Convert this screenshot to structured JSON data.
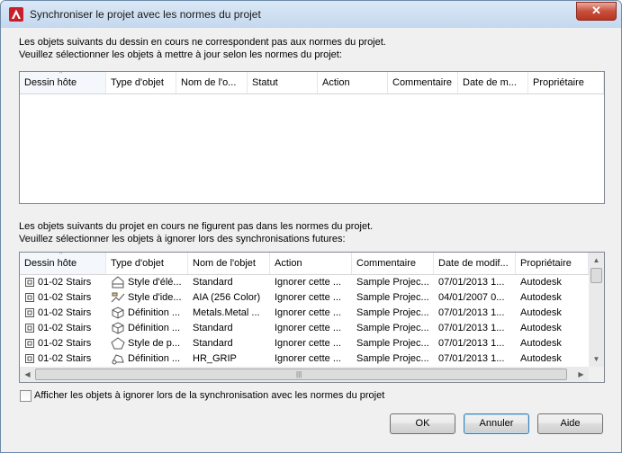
{
  "window": {
    "title": "Synchroniser le projet avec les normes du projet",
    "close_symbol": "✕"
  },
  "upper": {
    "intro_line1": "Les objets suivants du dessin en cours ne correspondent pas aux normes du projet.",
    "intro_line2": "Veuillez sélectionner les objets à mettre à jour selon les normes du projet:",
    "columns": [
      "Dessin hôte",
      "Type d'objet",
      "Nom de l'o...",
      "Statut",
      "Action",
      "Commentaire",
      "Date de m...",
      "Propriétaire"
    ]
  },
  "lower": {
    "intro_line1": "Les objets suivants du projet en cours ne figurent pas dans les normes du projet.",
    "intro_line2": "Veuillez sélectionner les objets à ignorer lors des synchronisations futures:",
    "columns": [
      "Dessin hôte",
      "Type d'objet",
      "Nom de l'objet",
      "Action",
      "Commentaire",
      "Date de modif...",
      "Propriétaire"
    ],
    "rows": [
      {
        "icon": "wall-style-icon",
        "host": "01-02 Stairs",
        "type": "Style d'élé...",
        "name": "Standard",
        "action": "Ignorer cette ...",
        "comment": "Sample Projec...",
        "date": "07/01/2013 1...",
        "owner": "Autodesk"
      },
      {
        "icon": "display-style-icon",
        "host": "01-02 Stairs",
        "type": "Style d'ide...",
        "name": "AIA (256 Color)",
        "action": "Ignorer cette ...",
        "comment": "Sample Projec...",
        "date": "04/01/2007 0...",
        "owner": "Autodesk"
      },
      {
        "icon": "material-definition-icon",
        "host": "01-02 Stairs",
        "type": "Définition ...",
        "name": "Metals.Metal ...",
        "action": "Ignorer cette ...",
        "comment": "Sample Projec...",
        "date": "07/01/2013 1...",
        "owner": "Autodesk"
      },
      {
        "icon": "material-definition-icon",
        "host": "01-02 Stairs",
        "type": "Définition ...",
        "name": "Standard",
        "action": "Ignorer cette ...",
        "comment": "Sample Projec...",
        "date": "07/01/2013 1...",
        "owner": "Autodesk"
      },
      {
        "icon": "pentagon-style-icon",
        "host": "01-02 Stairs",
        "type": "Style de p...",
        "name": "Standard",
        "action": "Ignorer cette ...",
        "comment": "Sample Projec...",
        "date": "07/01/2013 1...",
        "owner": "Autodesk"
      },
      {
        "icon": "grip-definition-icon",
        "host": "01-02 Stairs",
        "type": "Définition ...",
        "name": "HR_GRIP",
        "action": "Ignorer cette ...",
        "comment": "Sample Projec...",
        "date": "07/01/2013 1...",
        "owner": "Autodesk"
      }
    ],
    "scroll_up": "▲",
    "scroll_down": "▼",
    "scroll_left": "◀",
    "scroll_right": "▶",
    "grip": "|||"
  },
  "checkbox": {
    "label": "Afficher les objets à ignorer lors de la synchronisation avec les normes du projet",
    "checked": false
  },
  "buttons": {
    "ok": "OK",
    "cancel": "Annuler",
    "help": "Aide"
  },
  "sort_glyph": "^"
}
